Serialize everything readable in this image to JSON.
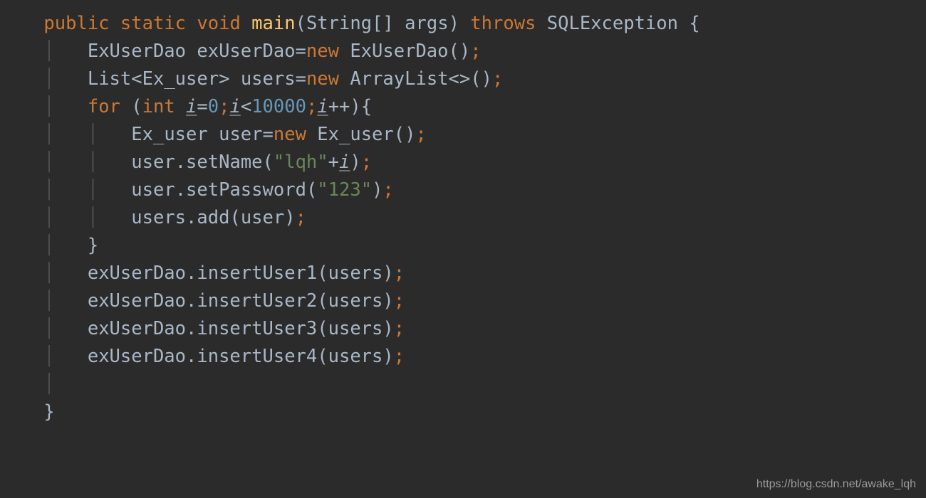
{
  "watermark": "https://blog.csdn.net/awake_lqh",
  "code": {
    "keywords": {
      "public": "public",
      "static": "static",
      "void": "void",
      "throws": "throws",
      "new": "new",
      "for": "for",
      "int": "int"
    },
    "fn_main": "main",
    "types": {
      "String_arr": "String[]",
      "args": "args",
      "SQLException": "SQLException",
      "ExUserDao": "ExUserDao",
      "List": "List",
      "Ex_user": "Ex_user",
      "ArrayList": "ArrayList"
    },
    "idents": {
      "exUserDao": "exUserDao",
      "users": "users",
      "user": "user",
      "i": "i"
    },
    "nums": {
      "zero": "0",
      "tenk": "10000"
    },
    "strs": {
      "lqh": "\"lqh\"",
      "pwd": "\"123\""
    },
    "methods": {
      "setName": "setName",
      "setPassword": "setPassword",
      "add": "add",
      "insertUser1": "insertUser1",
      "insertUser2": "insertUser2",
      "insertUser3": "insertUser3",
      "insertUser4": "insertUser4"
    },
    "punct": {
      "lbrace": "{",
      "rbrace": "}",
      "lparen": "(",
      "rparen": ")",
      "semi": ";",
      "comma": ",",
      "eq": "=",
      "lt": "<",
      "gt": ">",
      "plusplus": "++",
      "plus": "+",
      "diamond": "<>",
      "dot": "."
    }
  }
}
